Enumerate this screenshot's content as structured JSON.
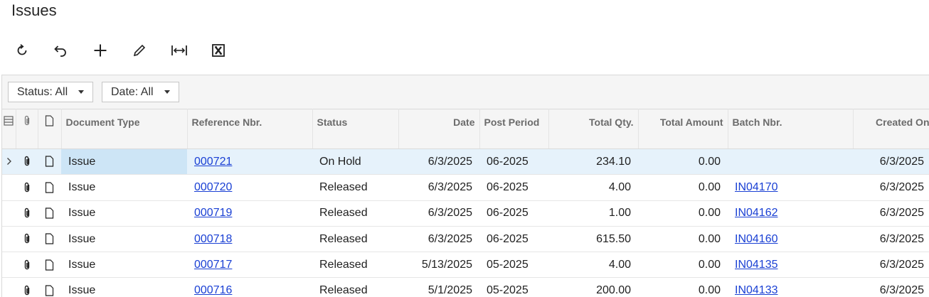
{
  "page": {
    "title": "Issues"
  },
  "toolbar": {
    "buttons": [
      {
        "name": "refresh-button",
        "icon": "refresh-icon"
      },
      {
        "name": "undo-button",
        "icon": "undo-icon"
      },
      {
        "name": "add-button",
        "icon": "plus-icon"
      },
      {
        "name": "edit-button",
        "icon": "pencil-icon"
      },
      {
        "name": "fit-to-screen-button",
        "icon": "fit-width-icon"
      },
      {
        "name": "export-excel-button",
        "icon": "excel-icon"
      }
    ]
  },
  "filters": {
    "status": "Status: All",
    "date": "Date: All"
  },
  "columns": {
    "document_type": "Document Type",
    "reference_nbr": "Reference Nbr.",
    "status": "Status",
    "date": "Date",
    "post_period": "Post Period",
    "total_qty": "Total Qty.",
    "total_amount": "Total Amount",
    "batch_nbr": "Batch Nbr.",
    "created_on": "Created On"
  },
  "rows": [
    {
      "type": "Issue",
      "ref": "000721",
      "status": "On Hold",
      "date": "6/3/2025",
      "period": "06-2025",
      "qty": "234.10",
      "amount": "0.00",
      "batch": "",
      "created": "6/3/2025"
    },
    {
      "type": "Issue",
      "ref": "000720",
      "status": "Released",
      "date": "6/3/2025",
      "period": "06-2025",
      "qty": "4.00",
      "amount": "0.00",
      "batch": "IN04170",
      "created": "6/3/2025"
    },
    {
      "type": "Issue",
      "ref": "000719",
      "status": "Released",
      "date": "6/3/2025",
      "period": "06-2025",
      "qty": "1.00",
      "amount": "0.00",
      "batch": "IN04162",
      "created": "6/3/2025"
    },
    {
      "type": "Issue",
      "ref": "000718",
      "status": "Released",
      "date": "6/3/2025",
      "period": "06-2025",
      "qty": "615.50",
      "amount": "0.00",
      "batch": "IN04160",
      "created": "6/3/2025"
    },
    {
      "type": "Issue",
      "ref": "000717",
      "status": "Released",
      "date": "5/13/2025",
      "period": "05-2025",
      "qty": "4.00",
      "amount": "0.00",
      "batch": "IN04135",
      "created": "6/3/2025"
    },
    {
      "type": "Issue",
      "ref": "000716",
      "status": "Released",
      "date": "5/1/2025",
      "period": "05-2025",
      "qty": "200.00",
      "amount": "0.00",
      "batch": "IN04133",
      "created": "6/3/2025"
    }
  ],
  "colors": {
    "link": "#1a40d4",
    "selected_row": "#e6f2fb",
    "active_cell": "#cde5f6"
  }
}
